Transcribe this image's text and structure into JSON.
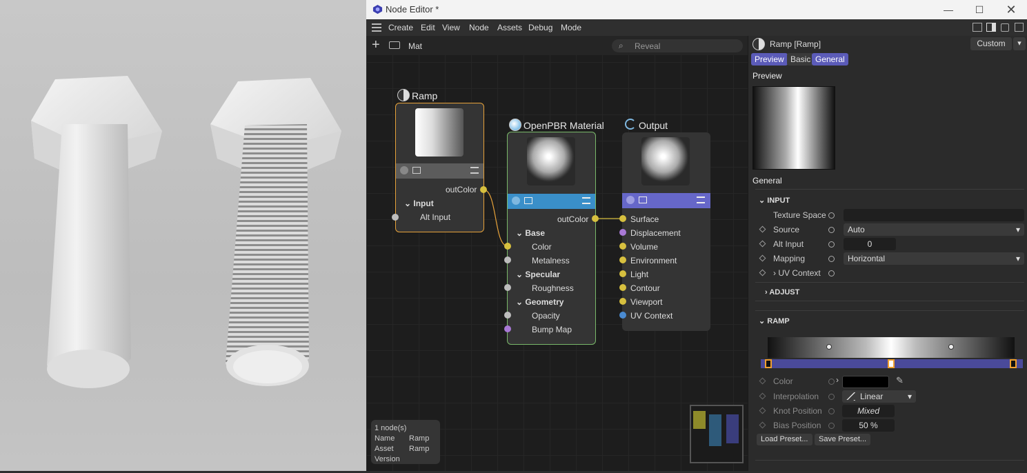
{
  "window": {
    "title": "Node Editor *"
  },
  "menu": [
    "Create",
    "Edit",
    "View",
    "Node",
    "Assets",
    "Debug",
    "Mode"
  ],
  "graph": {
    "breadcrumb": "Mat",
    "search_placeholder": "Reveal"
  },
  "nodes": {
    "ramp": {
      "title": "Ramp",
      "out_port": "outColor",
      "group": "Input",
      "ports": [
        "Alt Input"
      ]
    },
    "material": {
      "title": "OpenPBR Material",
      "out_port": "outColor",
      "groups": [
        {
          "name": "Base",
          "ports": [
            "Color",
            "Metalness"
          ]
        },
        {
          "name": "Specular",
          "ports": [
            "Roughness"
          ]
        },
        {
          "name": "Geometry",
          "ports": [
            "Opacity",
            "Bump Map"
          ]
        }
      ]
    },
    "output": {
      "title": "Output",
      "ports": [
        "Surface",
        "Displacement",
        "Volume",
        "Environment",
        "Light",
        "Contour",
        "Viewport",
        "UV Context"
      ]
    }
  },
  "info": {
    "count": "1 node(s)",
    "name_label": "Name",
    "name_value": "Ramp",
    "asset_label": "Asset",
    "asset_value": "Ramp",
    "version_label": "Version"
  },
  "props": {
    "title": "Ramp [Ramp]",
    "layout_button": "Custom",
    "tabs": [
      "Preview",
      "Basic",
      "General"
    ],
    "preview_heading": "Preview",
    "general_heading": "General",
    "input_section": "INPUT",
    "input_rows": [
      {
        "label": "Texture Space",
        "value": ""
      },
      {
        "label": "Source",
        "value": "Auto"
      },
      {
        "label": "Alt Input",
        "value": "0"
      },
      {
        "label": "Mapping",
        "value": "Horizontal"
      },
      {
        "label": "UV Context",
        "value": ""
      }
    ],
    "adjust_section": "ADJUST",
    "ramp_section": "RAMP",
    "knot_rows": [
      {
        "label": "Color",
        "value": ""
      },
      {
        "label": "Interpolation",
        "value": "Linear"
      },
      {
        "label": "Knot Position",
        "value": "Mixed"
      },
      {
        "label": "Bias Position",
        "value": "50 %"
      }
    ],
    "load_preset": "Load Preset...",
    "save_preset": "Save Preset..."
  },
  "colors": {
    "accent_purple": "#5b5bb8",
    "ramp_border": "#e8a33a",
    "material_border": "#7ab96a",
    "material_strip": "#3a8fc9",
    "output_strip": "#6667c9",
    "port_yellow": "#d7c03f",
    "port_purple": "#a979d6",
    "port_blue": "#4a8bd1",
    "port_grey": "#bdbdbd"
  }
}
